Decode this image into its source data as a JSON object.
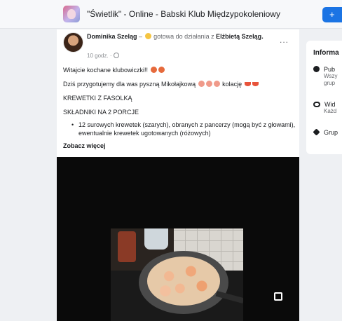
{
  "header": {
    "group_title": "\"Świetlik\" - Online - Babski Klub Międzypokoleniowy",
    "button_label": "+"
  },
  "post": {
    "author": "Dominika Szeląg",
    "activity_text": "gotowa do działania z",
    "tagged": "Elżbietą Szeląg",
    "time": "10 godz.",
    "lines": [
      "Witajcie kochane klubowiczki!!",
      "Dziś przygotujemy dla was pyszną Mikołajkową",
      "kolację",
      "KREWETKI Z FASOLKĄ",
      "SKŁADNIKI NA 2 PORCJE"
    ],
    "bullet": "12 surowych krewetek (szarych), obranych z pancerzy (mogą być z głowami), ewentualnie krewetek ugotowanych (różowych)",
    "see_more": "Zobacz więcej",
    "more_label": "..."
  },
  "info": {
    "title": "Informa",
    "rows": [
      {
        "label": "Pub",
        "sub1": "Wszy",
        "sub2": "grup"
      },
      {
        "label": "Wid",
        "sub1": "Każd"
      },
      {
        "label": "Grup"
      }
    ]
  },
  "colors": {
    "accent": "#1b74e4",
    "background": "#eef0f3"
  },
  "icons": [
    "group-thumbnail",
    "globe-icon",
    "eye-icon",
    "graduation-cap-icon",
    "fullscreen-icon",
    "more-icon"
  ]
}
